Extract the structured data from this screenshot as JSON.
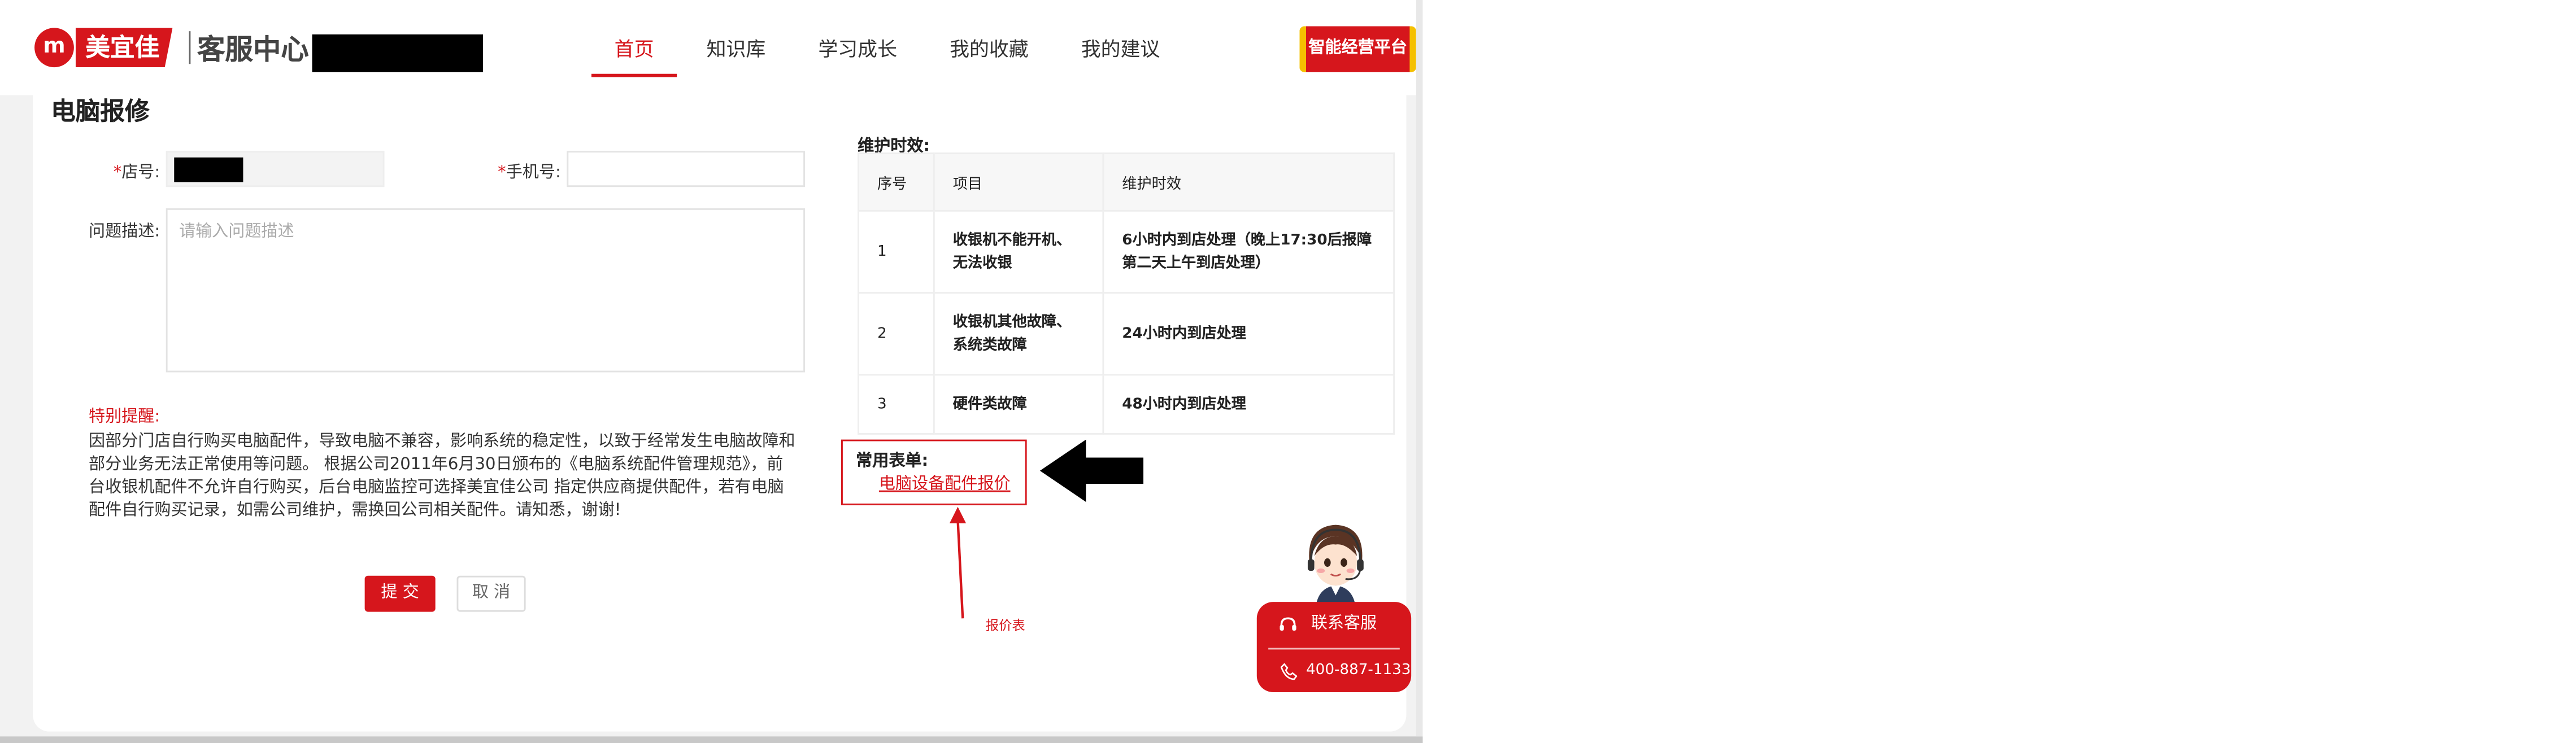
{
  "header": {
    "logo_char": "m",
    "brand": "美宜佳",
    "site_title": "客服中心",
    "nav": [
      {
        "label": "首页",
        "active": true
      },
      {
        "label": "知识库",
        "active": false
      },
      {
        "label": "学习成长",
        "active": false
      },
      {
        "label": "我的收藏",
        "active": false
      },
      {
        "label": "我的建议",
        "active": false
      }
    ],
    "platform_button": "智能经营平台"
  },
  "form": {
    "page_title": "电脑报修",
    "required_mark": "*",
    "shop_label": "店号:",
    "phone_label": "手机号:",
    "desc_label": "问题描述:",
    "desc_placeholder": "请输入问题描述",
    "notice_title": "特别提醒:",
    "notice_text": "因部分门店自行购买电脑配件，导致电脑不兼容，影响系统的稳定性，以致于经常发生电脑故障和部分业务无法正常使用等问题。 根据公司2011年6月30日颁布的《电脑系统配件管理规范》，前台收银机配件不允许自行购买，后台电脑监控可选择美宜佳公司 指定供应商提供配件，若有电脑配件自行购买记录，如需公司维护，需换回公司相关配件。请知悉，谢谢!",
    "submit": "提 交",
    "cancel": "取 消"
  },
  "sla": {
    "title": "维护时效:",
    "headers": [
      "序号",
      "项目",
      "维护时效"
    ],
    "rows": [
      {
        "no": "1",
        "item_line1": "收银机不能开机、",
        "item_line2": "无法收银",
        "time_line1": "6小时内到店处理（晚上17:30后报障",
        "time_line2": "第二天上午到店处理）"
      },
      {
        "no": "2",
        "item_line1": "收银机其他故障、",
        "item_line2": "系统类故障",
        "time_line1": "24小时内到店处理",
        "time_line2": ""
      },
      {
        "no": "3",
        "item_line1": "硬件类故障",
        "item_line2": "",
        "time_line1": "48小时内到店处理",
        "time_line2": ""
      }
    ]
  },
  "forms": {
    "title": "常用表单:",
    "link": "电脑设备配件报价"
  },
  "annotation": {
    "note": "报价表"
  },
  "customer_service": {
    "contact": "联系客服",
    "phone": "400-887-1133"
  },
  "colors": {
    "brand_red": "#d6161c",
    "accent_yellow": "#f5c000"
  },
  "icons": [
    "logo-icon",
    "headset-icon",
    "phone-icon",
    "left-arrow-icon",
    "up-arrow-icon",
    "avatar-icon"
  ]
}
